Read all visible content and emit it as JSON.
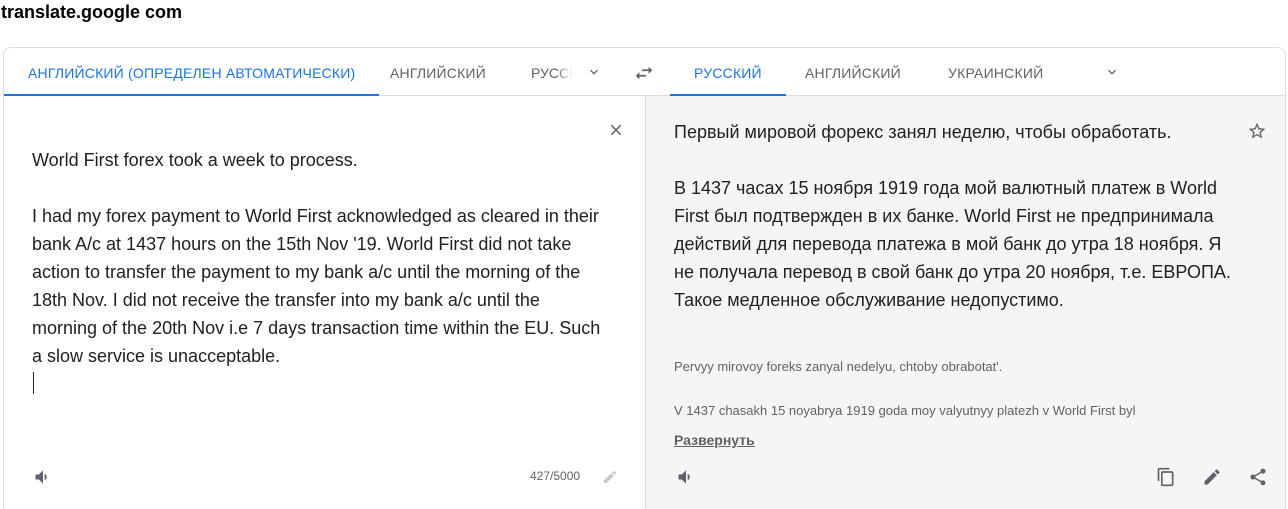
{
  "site_label": "translate.google com",
  "source_langs": {
    "detected": "АНГЛИЙСКИЙ (ОПРЕДЕЛЕН АВТОМАТИЧЕСКИ)",
    "lang2": "АНГЛИЙСКИЙ",
    "lang3": "РУССКИЙ"
  },
  "target_langs": {
    "lang1": "РУССКИЙ",
    "lang2": "АНГЛИЙСКИЙ",
    "lang3": "УКРАИНСКИЙ"
  },
  "source_text": "World First forex took a week to process.\n\nI had my forex payment to World First acknowledged as cleared in their bank A/c at 1437 hours on the 15th Nov '19. World First did not take action to transfer the payment to my bank a/c until the morning of the 18th Nov. I did not receive the transfer into my bank a/c until the morning of the 20th Nov i.e 7 days transaction time within the EU. Such a slow service is unacceptable.",
  "char_count": "427/5000",
  "target_text": "Первый мировой форекс занял неделю, чтобы обработать.\n\nВ 1437 часах 15 ноября 1919 года мой валютный платеж в World First был подтвержден в их банке. World First не предпринимала действий для перевода платежа в мой банк до утра 18 ноября. Я не получала перевод в свой банк до утра 20 ноября, т.е. ЕВРОПА. Такое медленное обслуживание недопустимо.",
  "transliteration_line1": "Pervyy mirovoy foreks zanyal nedelyu, chtoby obrabotat'.",
  "transliteration_line2": "V 1437 chasakh 15 noyabrya 1919 goda moy valyutnyy platezh v World First byl",
  "expand_label": "Развернуть",
  "colors": {
    "accent": "#1a73e8",
    "icon": "#5f6368",
    "right_pane_bg": "#f5f5f5"
  }
}
